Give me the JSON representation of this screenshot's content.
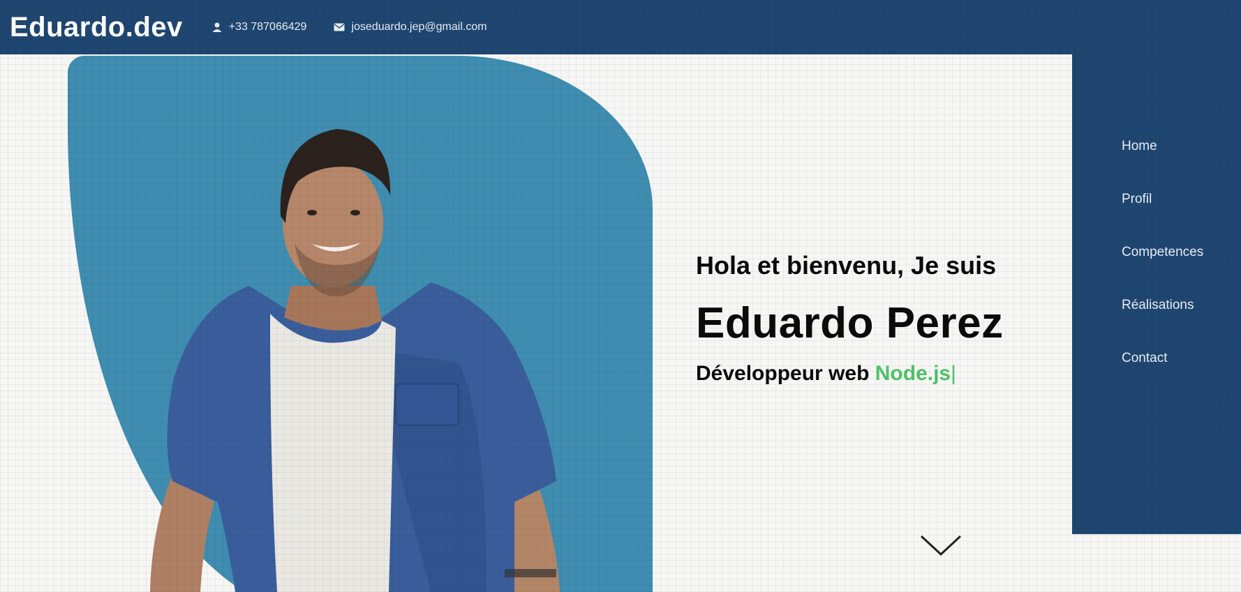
{
  "header": {
    "brand": "Eduardo.dev",
    "phone": "+33 787066429",
    "email": "joseduardo.jep@gmail.com",
    "phone_icon": "user-icon",
    "email_icon": "mail-icon",
    "background": "#1f4670"
  },
  "nav": {
    "items": [
      {
        "label": "Home"
      },
      {
        "label": "Profil"
      },
      {
        "label": "Competences"
      },
      {
        "label": "Réalisations"
      },
      {
        "label": "Contact"
      }
    ]
  },
  "hero": {
    "greeting": "Hola et bienvenu, Je suis",
    "name": "Eduardo Perez",
    "role_prefix": "Développeur web",
    "role_tech": "Node.js",
    "cursor": "|",
    "accent": "#4fc36a",
    "blob_color": "#3f8db0",
    "scroll_icon": "chevron-down-icon"
  }
}
